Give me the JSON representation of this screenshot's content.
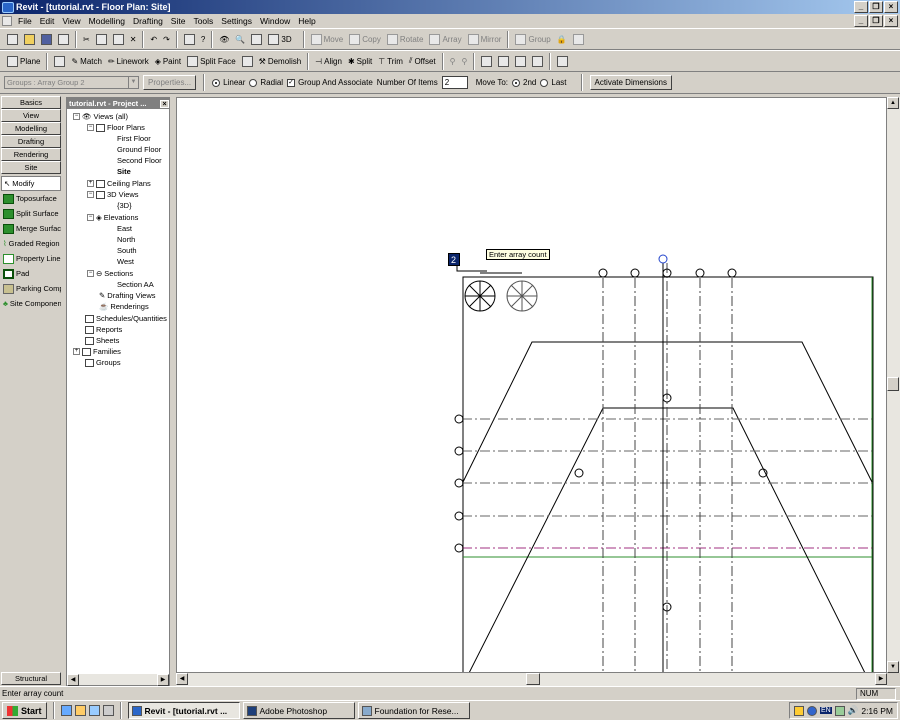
{
  "window": {
    "title": "Revit - [tutorial.rvt - Floor Plan: Site]"
  },
  "menu": [
    "File",
    "Edit",
    "View",
    "Modelling",
    "Drafting",
    "Site",
    "Tools",
    "Settings",
    "Window",
    "Help"
  ],
  "toolbar1": {
    "view3d": "3D",
    "move": "Move",
    "copy": "Copy",
    "rotate": "Rotate",
    "array": "Array",
    "mirror": "Mirror",
    "group": "Group"
  },
  "toolbar2": {
    "plane": "Plane",
    "match": "Match",
    "linework": "Linework",
    "paint": "Paint",
    "split_face": "Split Face",
    "demolish": "Demolish",
    "align": "Align",
    "split": "Split",
    "trim": "Trim",
    "offset": "Offset"
  },
  "options": {
    "type_selector": "Groups : Array Group 2",
    "properties": "Properties...",
    "linear": "Linear",
    "radial": "Radial",
    "group_assoc": "Group And Associate",
    "number_items_label": "Number Of Items",
    "number_items_value": "2",
    "move_to_label": "Move To:",
    "second": "2nd",
    "last": "Last",
    "activate_dims": "Activate Dimensions"
  },
  "design_bar": {
    "tabs": [
      "Basics",
      "View",
      "Modelling",
      "Drafting",
      "Rendering",
      "Site"
    ],
    "tools": [
      "Modify",
      "Toposurface",
      "Split Surface",
      "Merge Surfaces",
      "Graded Region",
      "Property Line",
      "Pad",
      "Parking Component",
      "Site Component"
    ],
    "bottom_tab": "Structural"
  },
  "project_browser": {
    "title": "tutorial.rvt - Project ...",
    "items": [
      {
        "label": "Views (all)",
        "expander": "−"
      },
      {
        "label": "Floor Plans",
        "expander": "−"
      },
      {
        "label": "First Floor"
      },
      {
        "label": "Ground Floor"
      },
      {
        "label": "Second Floor"
      },
      {
        "label": "Site"
      },
      {
        "label": "Ceiling Plans",
        "expander": "+"
      },
      {
        "label": "3D Views",
        "expander": "−"
      },
      {
        "label": "{3D}"
      },
      {
        "label": "Elevations",
        "expander": "−"
      },
      {
        "label": "East"
      },
      {
        "label": "North"
      },
      {
        "label": "South"
      },
      {
        "label": "West"
      },
      {
        "label": "Sections",
        "expander": "−"
      },
      {
        "label": "Section AA"
      },
      {
        "label": "Drafting Views"
      },
      {
        "label": "Renderings"
      },
      {
        "label": "Schedules/Quantities"
      },
      {
        "label": "Reports"
      },
      {
        "label": "Sheets"
      },
      {
        "label": "Families",
        "expander": "+"
      },
      {
        "label": "Groups"
      }
    ]
  },
  "canvas": {
    "array_count_value": "2",
    "tooltip": "Enter array count"
  },
  "status": {
    "prompt": "Enter array count",
    "num": "NUM"
  },
  "taskbar": {
    "start": "Start",
    "tasks": [
      "Revit - [tutorial.rvt ...",
      "Adobe Photoshop",
      "Foundation for Rese..."
    ],
    "lang": "EN",
    "clock": "2:16 PM"
  }
}
